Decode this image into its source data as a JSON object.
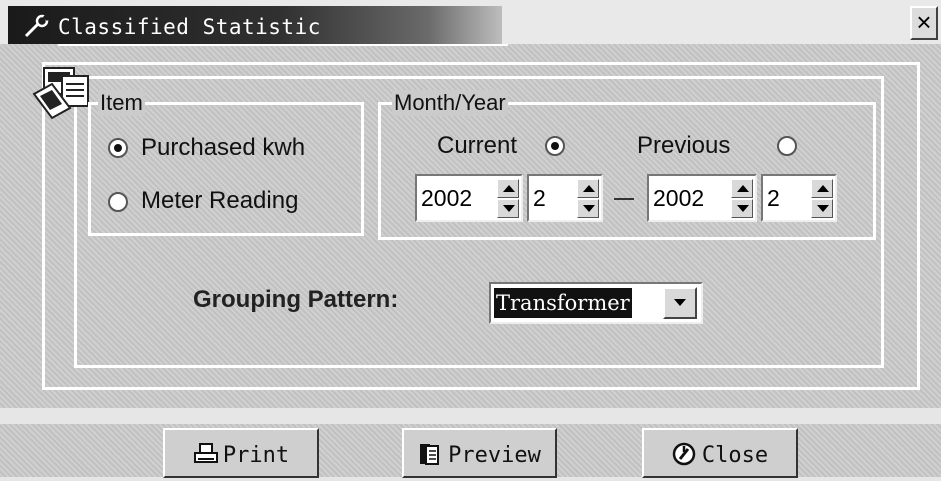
{
  "window": {
    "title": "Classified Statistic",
    "close_glyph": "×"
  },
  "item_group": {
    "label": "Item",
    "options": [
      {
        "label": "Purchased kwh",
        "selected": true
      },
      {
        "label": "Meter Reading",
        "selected": false
      }
    ]
  },
  "month_year_group": {
    "label": "Month/Year",
    "current_label": "Current",
    "current_selected": true,
    "previous_label": "Previous",
    "previous_selected": false,
    "from_year": "2002",
    "from_month": "2",
    "separator": "—",
    "to_year": "2002",
    "to_month": "2"
  },
  "grouping": {
    "label": "Grouping Pattern:",
    "value": "Transformer"
  },
  "buttons": {
    "print": "Print",
    "preview": "Preview",
    "close": "Close"
  },
  "icons": {
    "title": "wrench-icon",
    "corner": "report-forms-icon",
    "print": "printer-icon",
    "preview": "preview-pages-icon",
    "close": "close-circle-icon"
  },
  "colors": {
    "title_bar": "#1a1a1a",
    "dialog_bg": "#cbcbcb",
    "selection": "#111111"
  }
}
